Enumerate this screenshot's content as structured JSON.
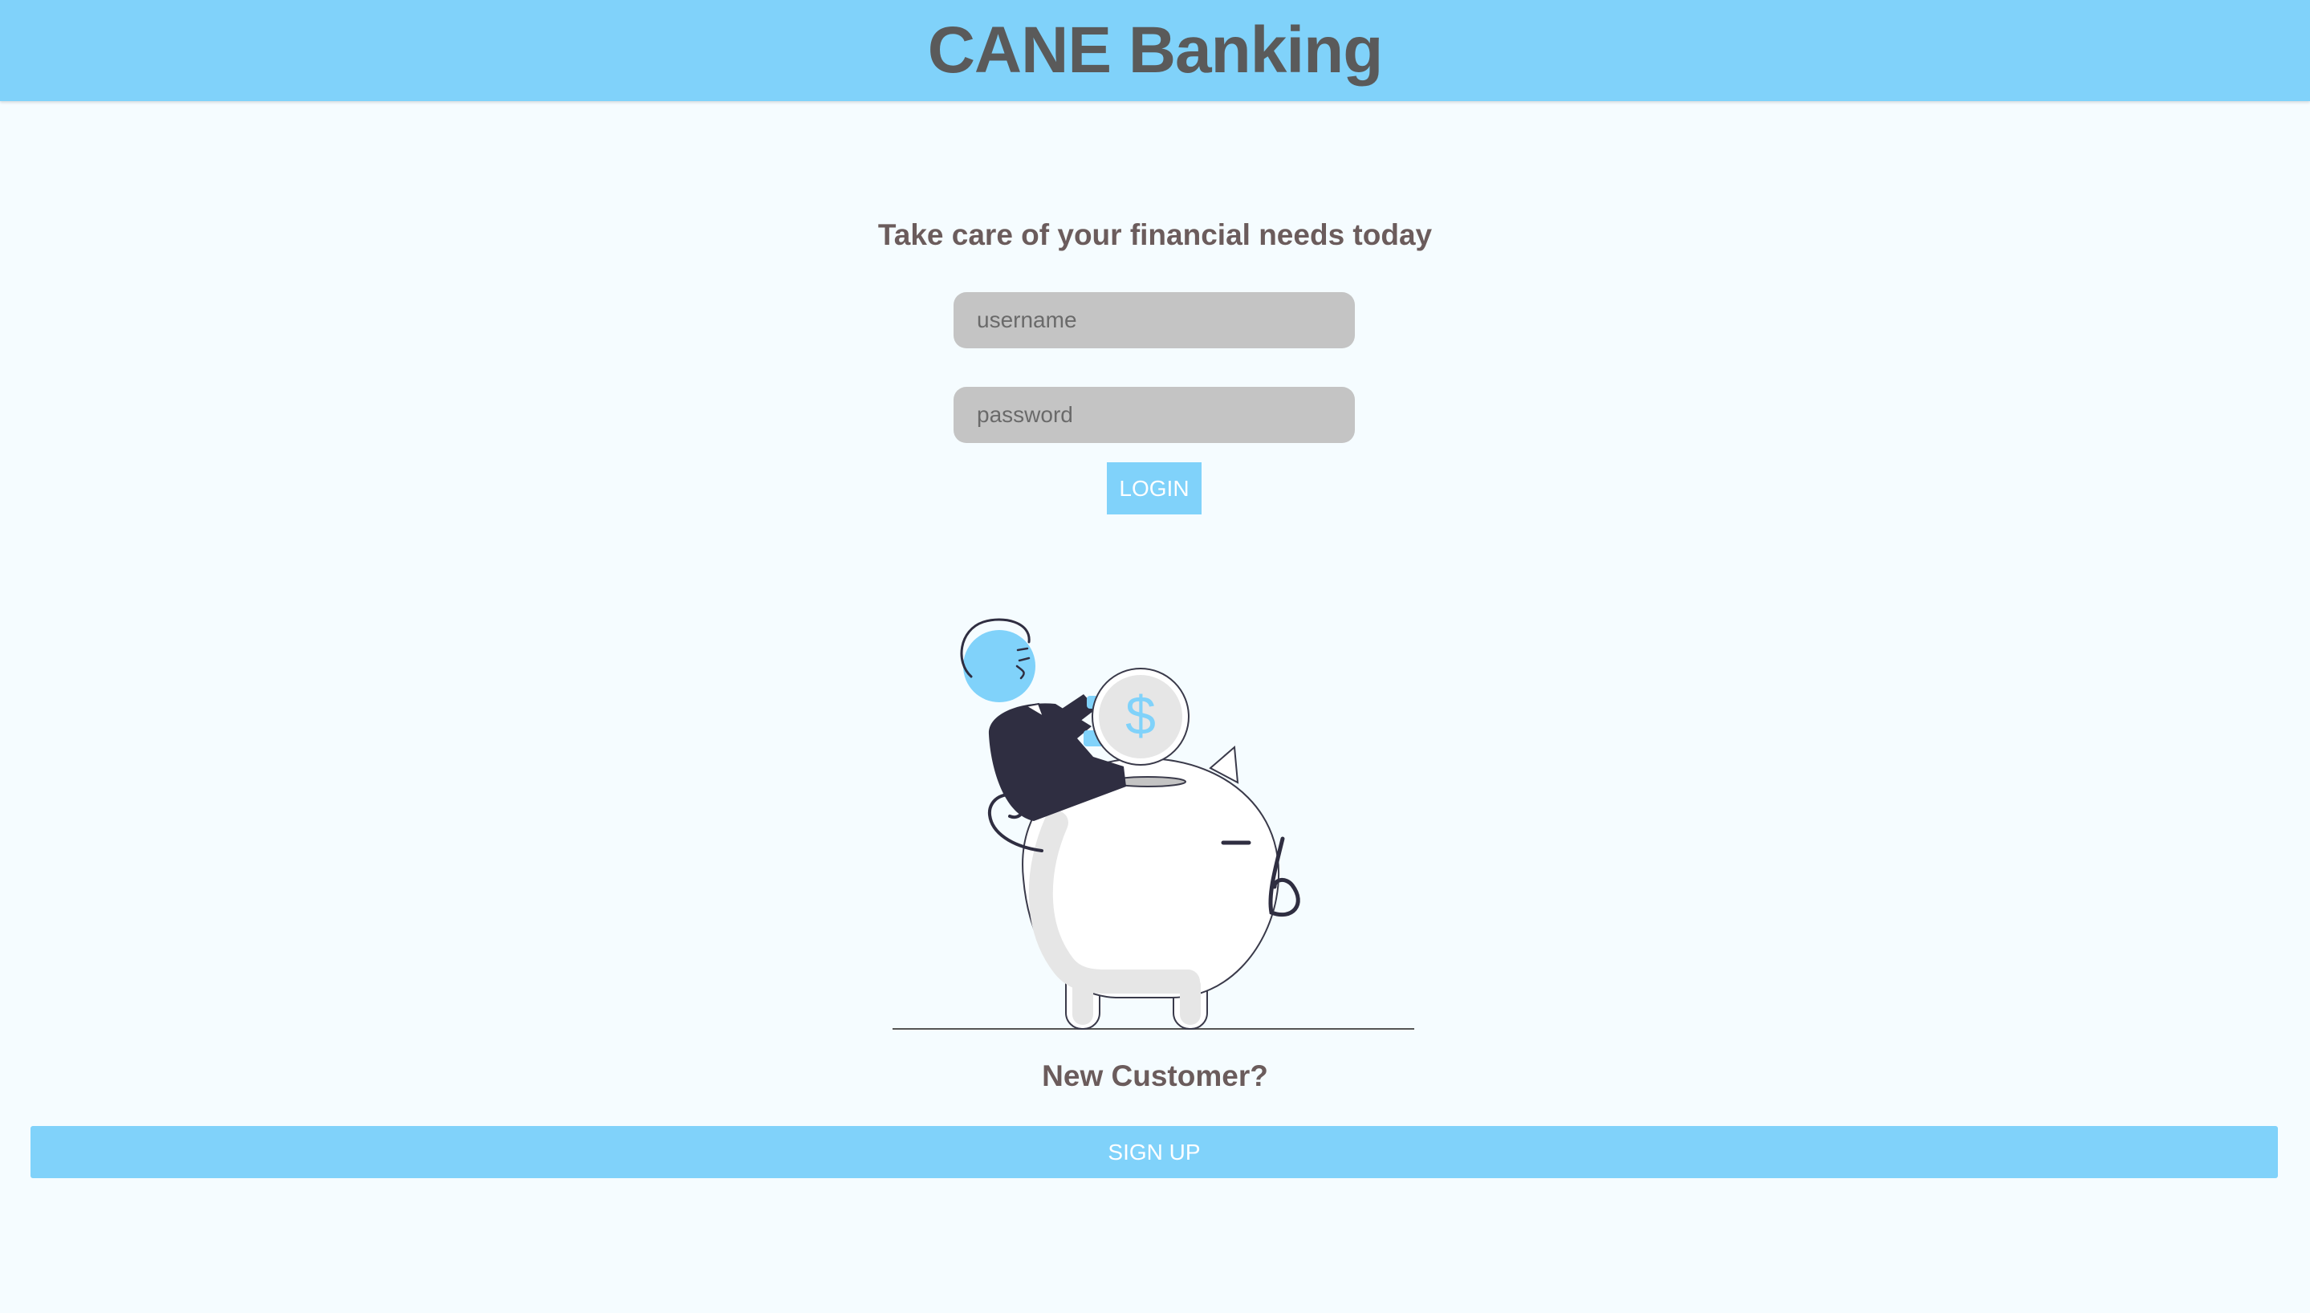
{
  "header": {
    "title": "CANE Banking"
  },
  "login": {
    "tagline": "Take care of your financial needs today",
    "username_placeholder": "username",
    "username_value": "",
    "password_placeholder": "password",
    "password_value": "",
    "login_label": "LOGIN"
  },
  "illustration": {
    "icon": "piggy-bank-illustration",
    "coin_symbol": "$"
  },
  "signup": {
    "prompt": "New Customer?",
    "button_label": "SIGN UP"
  },
  "colors": {
    "accent": "#80d2fa",
    "background": "#f5fcff",
    "field": "#c4c4c4",
    "heading_text": "#6b5c5c",
    "title_text": "#5a5a5a"
  }
}
